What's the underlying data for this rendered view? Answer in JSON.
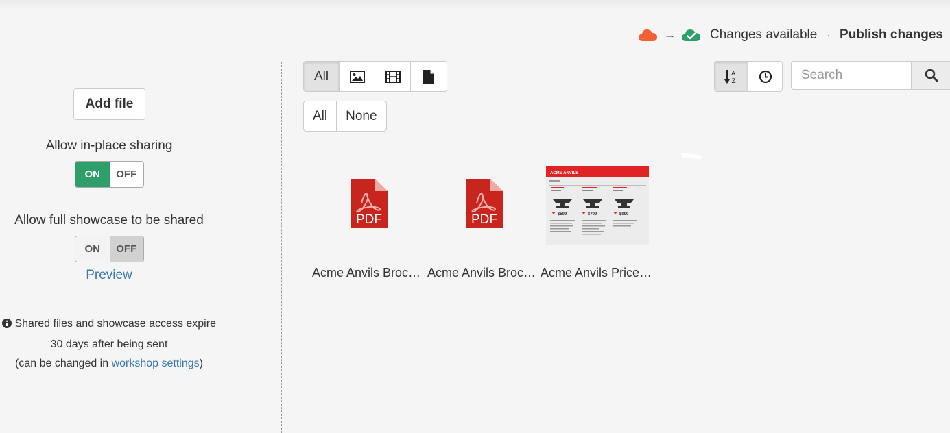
{
  "status": {
    "changes_text": "Changes available",
    "separator": "·",
    "publish_label": "Publish changes",
    "arrow": "→",
    "from_icon": "cloud-icon",
    "to_icon": "cloud-check-icon",
    "from_color": "#f26135",
    "to_color": "#2e9e6b"
  },
  "left": {
    "add_file_label": "Add file",
    "in_place_label": "Allow in-place sharing",
    "in_place_on": "ON",
    "in_place_off": "OFF",
    "showcase_label": "Allow full showcase to be shared",
    "showcase_on": "ON",
    "showcase_off": "OFF",
    "preview_label": "Preview",
    "info_line1": "Shared files and showcase access expire",
    "info_line2": "30 days after being sent",
    "info_line3_prefix": "(can be changed in ",
    "info_link": "workshop settings",
    "info_line3_suffix": ")"
  },
  "toolbar": {
    "filter_all": "All",
    "select_all": "All",
    "select_none": "None",
    "search_placeholder": "Search"
  },
  "files": [
    {
      "name": "Acme Anvils Brochure",
      "type": "pdf"
    },
    {
      "name": "Acme Anvils Brochure",
      "type": "pdf"
    },
    {
      "name": "Acme Anvils Price List",
      "type": "image"
    }
  ],
  "price_sheet": {
    "brand": "ACME ANVILS",
    "prices": [
      "$599",
      "$799",
      "$999"
    ]
  }
}
